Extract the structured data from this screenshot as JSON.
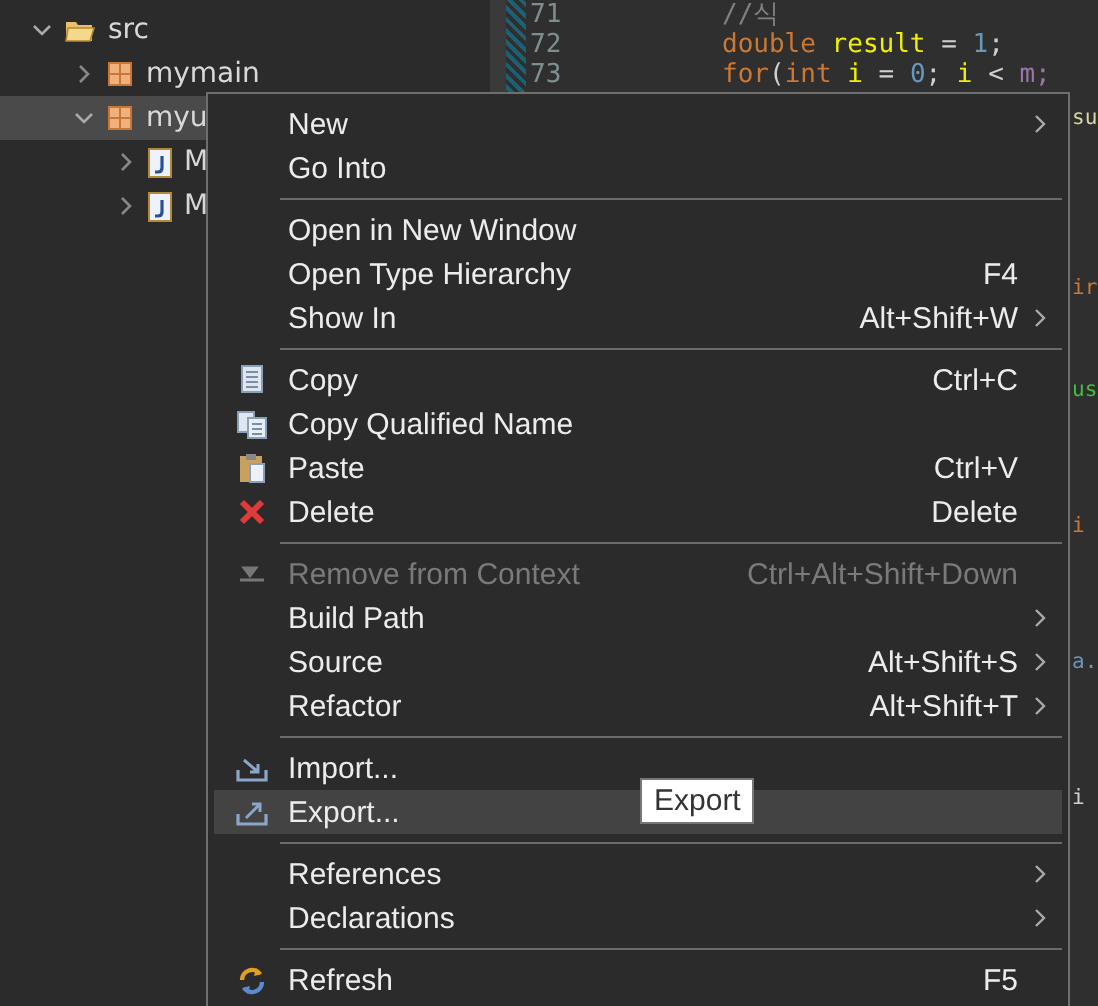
{
  "explorer": {
    "items": [
      {
        "label": "src",
        "kind": "folder",
        "expanded": true,
        "selected": false,
        "children": [
          {
            "label": "mymain",
            "kind": "package",
            "expanded": false,
            "selected": false
          },
          {
            "label": "myu",
            "kind": "package",
            "expanded": true,
            "selected": true,
            "children": [
              {
                "label": "M",
                "kind": "java",
                "expanded": false,
                "selected": false
              },
              {
                "label": "M",
                "kind": "java",
                "expanded": false,
                "selected": false
              }
            ]
          }
        ]
      }
    ]
  },
  "editor": {
    "lines": [
      {
        "number": "71",
        "tokens": [
          {
            "text": "//식",
            "kind": "comment"
          }
        ]
      },
      {
        "number": "72",
        "tokens": [
          {
            "text": "double ",
            "kind": "keyword"
          },
          {
            "text": "result",
            "kind": "variable"
          },
          {
            "text": " = ",
            "kind": "plain"
          },
          {
            "text": "1",
            "kind": "number"
          },
          {
            "text": ";",
            "kind": "plain"
          }
        ]
      },
      {
        "number": "73",
        "tokens": [
          {
            "text": "for",
            "kind": "keyword"
          },
          {
            "text": "(",
            "kind": "plain"
          },
          {
            "text": "int ",
            "kind": "keyword"
          },
          {
            "text": "i",
            "kind": "variable"
          },
          {
            "text": " = ",
            "kind": "plain"
          },
          {
            "text": "0",
            "kind": "number"
          },
          {
            "text": "; ",
            "kind": "plain"
          },
          {
            "text": "i",
            "kind": "variable"
          },
          {
            "text": " < ",
            "kind": "plain"
          },
          {
            "text": "m;",
            "kind": "field"
          }
        ]
      }
    ],
    "fragments": [
      {
        "text": "su",
        "color": "#d8d8a0"
      },
      {
        "text": "ir",
        "color": "#cc7832"
      },
      {
        "text": "us",
        "color": "#3ec13e"
      },
      {
        "text": "i",
        "color": "#cc7832"
      },
      {
        "text": "a.",
        "color": "#6897bb"
      },
      {
        "text": "i",
        "color": "#d0d0d0"
      }
    ]
  },
  "context_menu": {
    "items": [
      {
        "kind": "item",
        "label": "New",
        "submenu": true,
        "disabled": false,
        "selected": false
      },
      {
        "kind": "item",
        "label": "Go Into",
        "submenu": false,
        "disabled": false,
        "selected": false
      },
      {
        "kind": "separator"
      },
      {
        "kind": "item",
        "label": "Open in New Window",
        "submenu": false,
        "disabled": false,
        "selected": false
      },
      {
        "kind": "item",
        "label": "Open Type Hierarchy",
        "shortcut": "F4",
        "submenu": false,
        "disabled": false,
        "selected": false
      },
      {
        "kind": "item",
        "label": "Show In",
        "shortcut": "Alt+Shift+W",
        "submenu": true,
        "disabled": false,
        "selected": false
      },
      {
        "kind": "separator"
      },
      {
        "kind": "item",
        "label": "Copy",
        "shortcut": "Ctrl+C",
        "submenu": false,
        "disabled": false,
        "selected": false
      },
      {
        "kind": "item",
        "label": "Copy Qualified Name",
        "submenu": false,
        "disabled": false,
        "selected": false
      },
      {
        "kind": "item",
        "label": "Paste",
        "shortcut": "Ctrl+V",
        "submenu": false,
        "disabled": false,
        "selected": false
      },
      {
        "kind": "item",
        "label": "Delete",
        "shortcut": "Delete",
        "submenu": false,
        "disabled": false,
        "selected": false
      },
      {
        "kind": "separator"
      },
      {
        "kind": "item",
        "label": "Remove from Context",
        "shortcut": "Ctrl+Alt+Shift+Down",
        "submenu": false,
        "disabled": true,
        "selected": false
      },
      {
        "kind": "item",
        "label": "Build Path",
        "submenu": true,
        "disabled": false,
        "selected": false
      },
      {
        "kind": "item",
        "label": "Source",
        "shortcut": "Alt+Shift+S",
        "submenu": true,
        "disabled": false,
        "selected": false
      },
      {
        "kind": "item",
        "label": "Refactor",
        "shortcut": "Alt+Shift+T",
        "submenu": true,
        "disabled": false,
        "selected": false
      },
      {
        "kind": "separator"
      },
      {
        "kind": "item",
        "label": "Import...",
        "submenu": false,
        "disabled": false,
        "selected": false
      },
      {
        "kind": "item",
        "label": "Export...",
        "submenu": false,
        "disabled": false,
        "selected": true
      },
      {
        "kind": "separator"
      },
      {
        "kind": "item",
        "label": "References",
        "submenu": true,
        "disabled": false,
        "selected": false
      },
      {
        "kind": "item",
        "label": "Declarations",
        "submenu": true,
        "disabled": false,
        "selected": false
      },
      {
        "kind": "separator"
      },
      {
        "kind": "item",
        "label": "Refresh",
        "shortcut": "F5",
        "submenu": false,
        "disabled": false,
        "selected": false
      }
    ]
  },
  "tooltip": {
    "text": "Export"
  }
}
